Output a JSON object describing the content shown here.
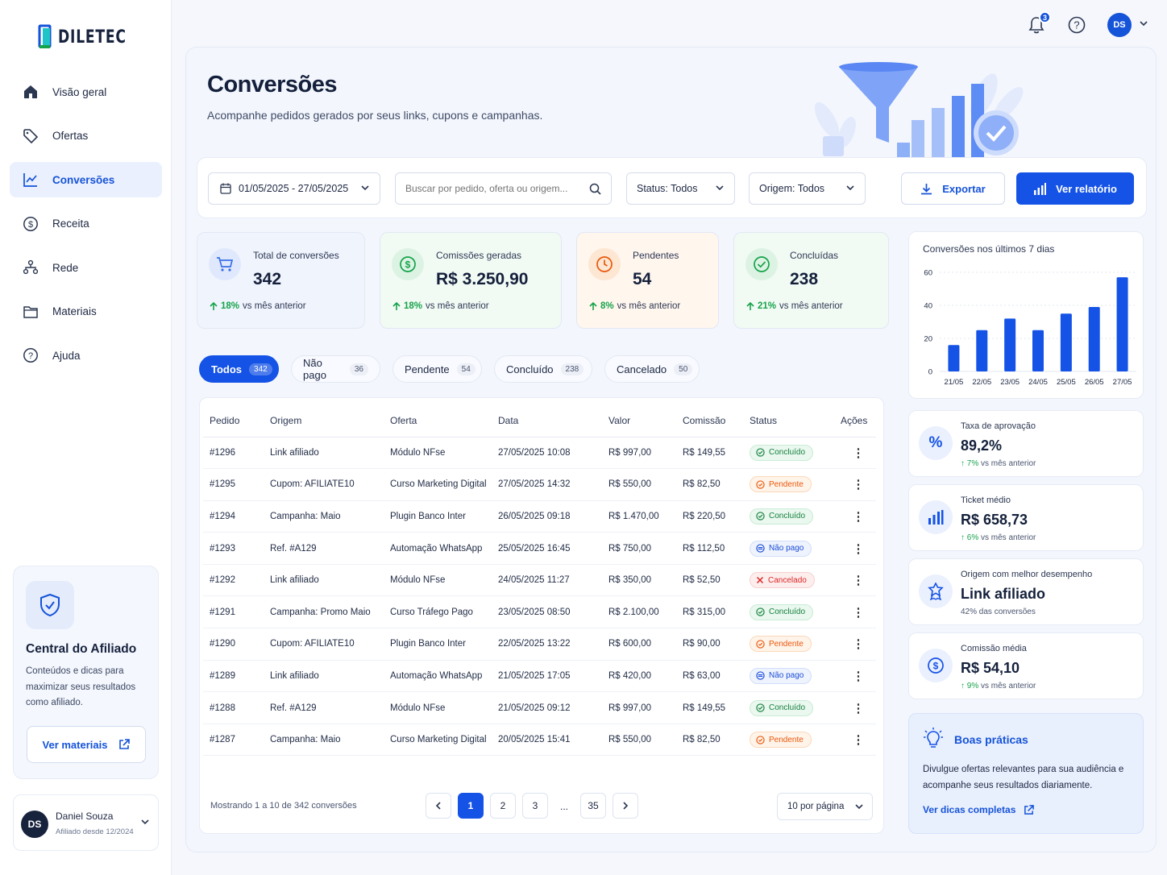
{
  "brand": {
    "name": "DILETEC"
  },
  "sidebar": {
    "items": [
      {
        "label": "Visão geral",
        "icon": "home-icon"
      },
      {
        "label": "Ofertas",
        "icon": "tag-icon"
      },
      {
        "label": "Conversões",
        "icon": "chart-line-icon",
        "active": true
      },
      {
        "label": "Receita",
        "icon": "dollar-circle-icon"
      },
      {
        "label": "Rede",
        "icon": "network-icon"
      },
      {
        "label": "Materiais",
        "icon": "folder-icon"
      },
      {
        "label": "Ajuda",
        "icon": "help-circle-icon"
      }
    ],
    "help_card": {
      "title": "Central do Afiliado",
      "desc": "Conteúdos e dicas para maximizar seus resultados como afiliado.",
      "button": "Ver materiais"
    },
    "user": {
      "initials": "DS",
      "name": "Daniel Souza",
      "since": "Afiliado desde 12/2024"
    }
  },
  "topbar": {
    "notifications": "3",
    "avatar": "DS"
  },
  "page": {
    "title": "Conversões",
    "subtitle": "Acompanhe pedidos gerados por seus links, cupons e campanhas."
  },
  "filters": {
    "date_range": "01/05/2025 - 27/05/2025",
    "search_placeholder": "Buscar por pedido, oferta ou origem...",
    "status": "Status: Todos",
    "origin": "Origem: Todos",
    "export": "Exportar",
    "report": "Ver relatório"
  },
  "stats": [
    {
      "label": "Total de conversões",
      "value": "342",
      "trend": "18%",
      "trend_text": "vs mês anterior",
      "color": "#3b6fe8"
    },
    {
      "label": "Comissões geradas",
      "value": "R$ 3.250,90",
      "trend": "18%",
      "trend_text": "vs mês anterior",
      "color": "#16a34a"
    },
    {
      "label": "Pendentes",
      "value": "54",
      "trend": "8%",
      "trend_text": "vs mês anterior",
      "color": "#ea580c"
    },
    {
      "label": "Concluídas",
      "value": "238",
      "trend": "21%",
      "trend_text": "vs mês anterior",
      "color": "#16a34a"
    }
  ],
  "tabs": [
    {
      "label": "Todos",
      "count": "342",
      "active": true
    },
    {
      "label": "Não pago",
      "count": "36"
    },
    {
      "label": "Pendente",
      "count": "54"
    },
    {
      "label": "Concluído",
      "count": "238"
    },
    {
      "label": "Cancelado",
      "count": "50"
    }
  ],
  "table": {
    "headers": [
      "Pedido",
      "Origem",
      "Oferta",
      "Data",
      "Valor",
      "Comissão",
      "Status",
      "Ações"
    ],
    "rows": [
      [
        "#1296",
        "Link afiliado",
        "Módulo NFse",
        "27/05/2025 10:08",
        "R$ 997,00",
        "R$ 149,55",
        "Concluído"
      ],
      [
        "#1295",
        "Cupom: AFILIATE10",
        "Curso Marketing Digital",
        "27/05/2025 14:32",
        "R$ 550,00",
        "R$ 82,50",
        "Pendente"
      ],
      [
        "#1294",
        "Campanha: Maio",
        "Plugin Banco Inter",
        "26/05/2025 09:18",
        "R$ 1.470,00",
        "R$ 220,50",
        "Concluído"
      ],
      [
        "#1293",
        "Ref. #A129",
        "Automação WhatsApp",
        "25/05/2025 16:45",
        "R$ 750,00",
        "R$ 112,50",
        "Não pago"
      ],
      [
        "#1292",
        "Link afiliado",
        "Módulo NFse",
        "24/05/2025 11:27",
        "R$ 350,00",
        "R$ 52,50",
        "Cancelado"
      ],
      [
        "#1291",
        "Campanha: Promo Maio",
        "Curso Tráfego Pago",
        "23/05/2025 08:50",
        "R$ 2.100,00",
        "R$ 315,00",
        "Concluído"
      ],
      [
        "#1290",
        "Cupom: AFILIATE10",
        "Plugin Banco Inter",
        "22/05/2025 13:22",
        "R$ 600,00",
        "R$ 90,00",
        "Pendente"
      ],
      [
        "#1289",
        "Link afiliado",
        "Automação WhatsApp",
        "21/05/2025 17:05",
        "R$ 420,00",
        "R$ 63,00",
        "Não pago"
      ],
      [
        "#1288",
        "Ref. #A129",
        "Módulo NFse",
        "21/05/2025 09:12",
        "R$ 997,00",
        "R$ 149,55",
        "Concluído"
      ],
      [
        "#1287",
        "Campanha: Maio",
        "Curso Marketing Digital",
        "20/05/2025 15:41",
        "R$ 550,00",
        "R$ 82,50",
        "Pendente"
      ]
    ]
  },
  "pagination": {
    "showing": "Mostrando 1 a 10 de 342 conversões",
    "pages": [
      "1",
      "2",
      "3",
      "...",
      "35"
    ],
    "current": "1",
    "per_page": "10 por página"
  },
  "chart_data": {
    "type": "bar",
    "title": "Conversões nos últimos 7 dias",
    "categories": [
      "21/05",
      "22/05",
      "23/05",
      "24/05",
      "25/05",
      "26/05",
      "27/05"
    ],
    "values": [
      16,
      25,
      32,
      25,
      35,
      39,
      57
    ],
    "yticks": [
      "0",
      "20",
      "40",
      "60"
    ],
    "ylim": [
      0,
      60
    ],
    "color": "#1553e6"
  },
  "metrics": [
    {
      "label": "Taxa de aprovação",
      "value": "89,2%",
      "trend": "↑ 7%",
      "trend_text": "vs mês anterior",
      "icon": "percent-icon"
    },
    {
      "label": "Ticket médio",
      "value": "R$ 658,73",
      "trend": "↑ 6%",
      "trend_text": "vs mês anterior",
      "icon": "bar-chart-icon"
    },
    {
      "label": "Origem com melhor desempenho",
      "value": "Link afiliado",
      "trend": "42%",
      "trend_text": "das conversões",
      "icon": "award-icon"
    },
    {
      "label": "Comissão média",
      "value": "R$ 54,10",
      "trend": "↑ 9%",
      "trend_text": "vs mês anterior",
      "icon": "dollar-circle-icon"
    }
  ],
  "tips": {
    "title": "Boas práticas",
    "desc": "Divulgue ofertas relevantes para sua audiência e acompanhe seus resultados diariamente.",
    "link": "Ver dicas completas"
  }
}
